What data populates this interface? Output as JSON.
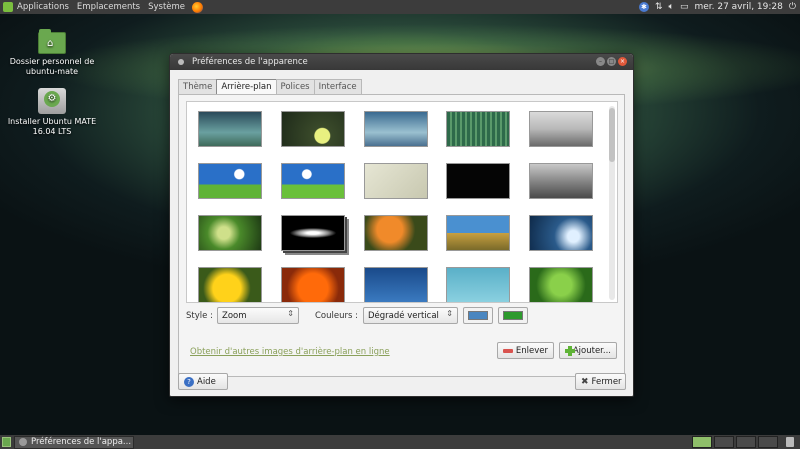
{
  "top_panel": {
    "menus": [
      "Applications",
      "Emplacements",
      "Système"
    ],
    "clock": "mer. 27 avril, 19:28"
  },
  "desktop": {
    "icons": [
      {
        "label": "Dossier personnel de ubuntu-mate"
      },
      {
        "label": "Installer Ubuntu MATE 16.04 LTS"
      }
    ]
  },
  "window": {
    "title": "Préférences de l'apparence",
    "tabs": [
      "Thème",
      "Arrière-plan",
      "Polices",
      "Interface"
    ],
    "active_tab": "Arrière-plan",
    "style_label": "Style :",
    "style_value": "Zoom",
    "colors_label": "Couleurs :",
    "colors_value": "Dégradé vertical",
    "color1": "#4a86c0",
    "color2": "#2d9a2d",
    "more_link": "Obtenir d'autres images d'arrière-plan en ligne",
    "remove_button": "Enlever",
    "add_button": "Ajouter...",
    "help_button": "Aide",
    "close_button": "Fermer",
    "wallpapers": [
      "wallpaper-teal-sky",
      "wallpaper-green-sunset",
      "wallpaper-blue-haze",
      "wallpaper-green-stripes",
      "wallpaper-beach-grey",
      "wallpaper-blue-sky-field",
      "wallpaper-sky-field-2",
      "wallpaper-light-texture",
      "wallpaper-black",
      "wallpaper-town-square",
      "wallpaper-green-leaves",
      "wallpaper-galaxy",
      "wallpaper-orange-flower",
      "wallpaper-grass-sky",
      "wallpaper-water-drop",
      "wallpaper-yellow-flower",
      "wallpaper-orange-petals",
      "wallpaper-blue-water",
      "wallpaper-aqua",
      "wallpaper-green-leaf"
    ]
  },
  "taskbar": {
    "task": "Préférences de l'appa..."
  }
}
